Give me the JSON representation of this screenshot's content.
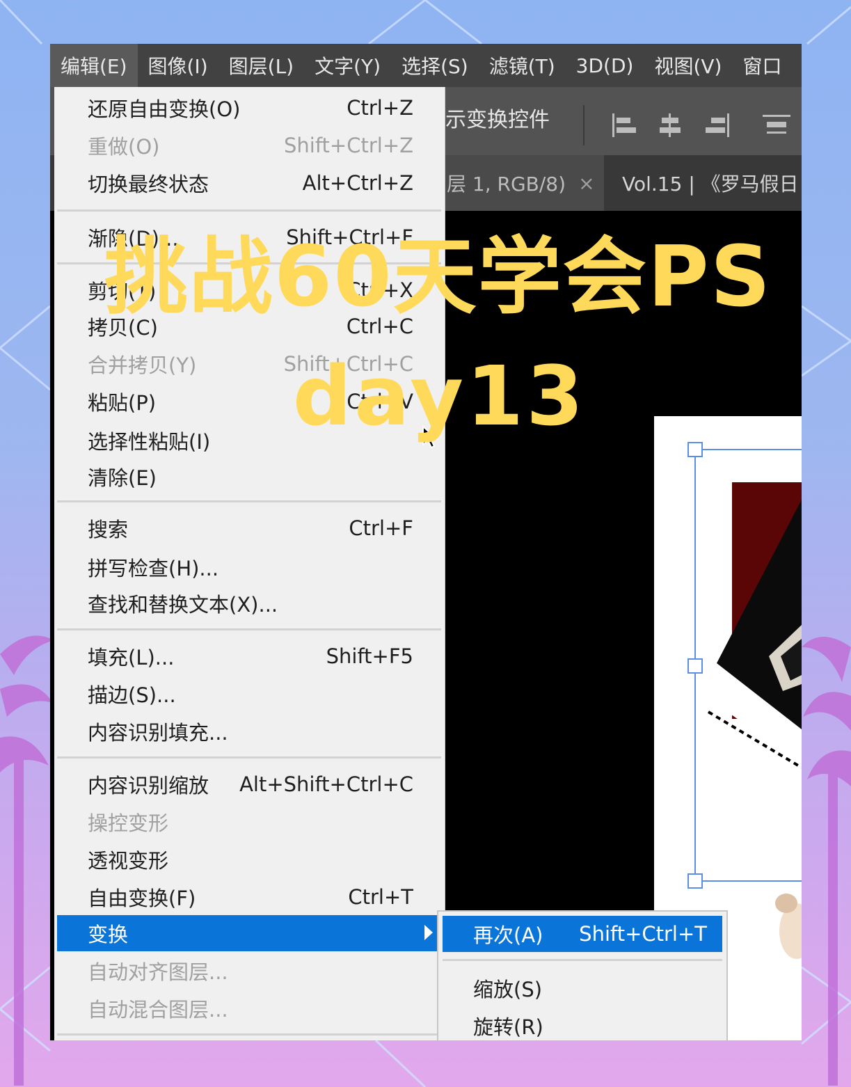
{
  "menubar": {
    "items": [
      "编辑(E)",
      "图像(I)",
      "图层(L)",
      "文字(Y)",
      "选择(S)",
      "滤镜(T)",
      "3D(D)",
      "视图(V)",
      "窗口"
    ]
  },
  "options_bar": {
    "label": "示变换控件"
  },
  "tabs": {
    "tab1": "层 1, RGB/8)",
    "tab1_close": "×",
    "tab2": "Vol.15 | 《罗马假日"
  },
  "edit_menu": {
    "items": [
      {
        "label": "还原自由变换(O)",
        "shortcut": "Ctrl+Z"
      },
      {
        "label": "重做(O)",
        "shortcut": "Shift+Ctrl+Z"
      },
      {
        "label": "切换最终状态",
        "shortcut": "Alt+Ctrl+Z"
      },
      {
        "label": "渐隐(D)...",
        "shortcut": "Shift+Ctrl+F"
      },
      {
        "label": "剪切(T)",
        "shortcut": "Ctrl+X"
      },
      {
        "label": "拷贝(C)",
        "shortcut": "Ctrl+C"
      },
      {
        "label": "合并拷贝(Y)",
        "shortcut": "Shift+Ctrl+C"
      },
      {
        "label": "粘贴(P)",
        "shortcut": "Ctrl+V"
      },
      {
        "label": "选择性粘贴(I)",
        "shortcut": ""
      },
      {
        "label": "清除(E)",
        "shortcut": ""
      },
      {
        "label": "搜索",
        "shortcut": "Ctrl+F"
      },
      {
        "label": "拼写检查(H)...",
        "shortcut": ""
      },
      {
        "label": "查找和替换文本(X)...",
        "shortcut": ""
      },
      {
        "label": "填充(L)...",
        "shortcut": "Shift+F5"
      },
      {
        "label": "描边(S)...",
        "shortcut": ""
      },
      {
        "label": "内容识别填充...",
        "shortcut": ""
      },
      {
        "label": "内容识别缩放",
        "shortcut": "Alt+Shift+Ctrl+C"
      },
      {
        "label": "操控变形",
        "shortcut": ""
      },
      {
        "label": "透视变形",
        "shortcut": ""
      },
      {
        "label": "自由变换(F)",
        "shortcut": "Ctrl+T"
      },
      {
        "label": "变换",
        "shortcut": ""
      },
      {
        "label": "自动对齐图层...",
        "shortcut": ""
      },
      {
        "label": "自动混合图层...",
        "shortcut": ""
      }
    ]
  },
  "transform_submenu": {
    "items": [
      {
        "label": "再次(A)",
        "shortcut": "Shift+Ctrl+T"
      },
      {
        "label": "缩放(S)",
        "shortcut": ""
      },
      {
        "label": "旋转(R)",
        "shortcut": ""
      }
    ]
  },
  "overlay": {
    "line1": "挑战60天学会PS",
    "line2": "day13"
  },
  "colors": {
    "menu_highlight": "#0a74d8",
    "overlay_text": "#ffd95a",
    "menubar_bg": "#424242",
    "menu_bg": "#f0f0f0"
  }
}
